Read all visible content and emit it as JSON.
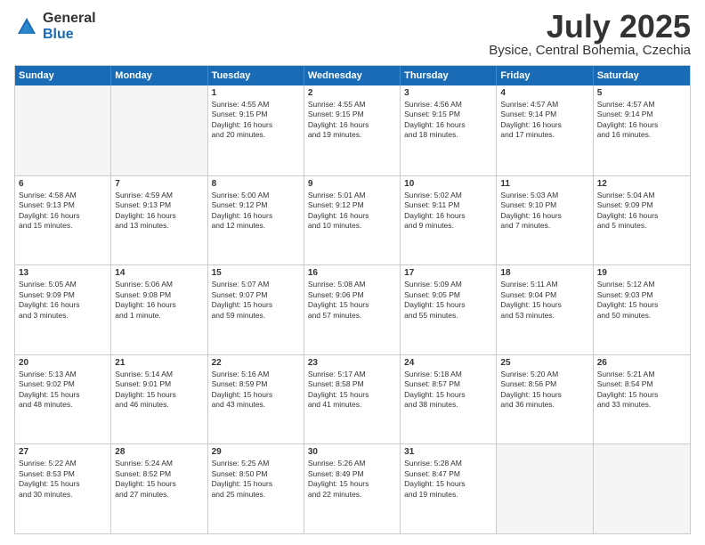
{
  "header": {
    "logo_general": "General",
    "logo_blue": "Blue",
    "title": "July 2025",
    "location": "Bysice, Central Bohemia, Czechia"
  },
  "days_of_week": [
    "Sunday",
    "Monday",
    "Tuesday",
    "Wednesday",
    "Thursday",
    "Friday",
    "Saturday"
  ],
  "weeks": [
    [
      {
        "day": "",
        "lines": [],
        "empty": true
      },
      {
        "day": "",
        "lines": [],
        "empty": true
      },
      {
        "day": "1",
        "lines": [
          "Sunrise: 4:55 AM",
          "Sunset: 9:15 PM",
          "Daylight: 16 hours",
          "and 20 minutes."
        ],
        "empty": false
      },
      {
        "day": "2",
        "lines": [
          "Sunrise: 4:55 AM",
          "Sunset: 9:15 PM",
          "Daylight: 16 hours",
          "and 19 minutes."
        ],
        "empty": false
      },
      {
        "day": "3",
        "lines": [
          "Sunrise: 4:56 AM",
          "Sunset: 9:15 PM",
          "Daylight: 16 hours",
          "and 18 minutes."
        ],
        "empty": false
      },
      {
        "day": "4",
        "lines": [
          "Sunrise: 4:57 AM",
          "Sunset: 9:14 PM",
          "Daylight: 16 hours",
          "and 17 minutes."
        ],
        "empty": false
      },
      {
        "day": "5",
        "lines": [
          "Sunrise: 4:57 AM",
          "Sunset: 9:14 PM",
          "Daylight: 16 hours",
          "and 16 minutes."
        ],
        "empty": false
      }
    ],
    [
      {
        "day": "6",
        "lines": [
          "Sunrise: 4:58 AM",
          "Sunset: 9:13 PM",
          "Daylight: 16 hours",
          "and 15 minutes."
        ],
        "empty": false
      },
      {
        "day": "7",
        "lines": [
          "Sunrise: 4:59 AM",
          "Sunset: 9:13 PM",
          "Daylight: 16 hours",
          "and 13 minutes."
        ],
        "empty": false
      },
      {
        "day": "8",
        "lines": [
          "Sunrise: 5:00 AM",
          "Sunset: 9:12 PM",
          "Daylight: 16 hours",
          "and 12 minutes."
        ],
        "empty": false
      },
      {
        "day": "9",
        "lines": [
          "Sunrise: 5:01 AM",
          "Sunset: 9:12 PM",
          "Daylight: 16 hours",
          "and 10 minutes."
        ],
        "empty": false
      },
      {
        "day": "10",
        "lines": [
          "Sunrise: 5:02 AM",
          "Sunset: 9:11 PM",
          "Daylight: 16 hours",
          "and 9 minutes."
        ],
        "empty": false
      },
      {
        "day": "11",
        "lines": [
          "Sunrise: 5:03 AM",
          "Sunset: 9:10 PM",
          "Daylight: 16 hours",
          "and 7 minutes."
        ],
        "empty": false
      },
      {
        "day": "12",
        "lines": [
          "Sunrise: 5:04 AM",
          "Sunset: 9:09 PM",
          "Daylight: 16 hours",
          "and 5 minutes."
        ],
        "empty": false
      }
    ],
    [
      {
        "day": "13",
        "lines": [
          "Sunrise: 5:05 AM",
          "Sunset: 9:09 PM",
          "Daylight: 16 hours",
          "and 3 minutes."
        ],
        "empty": false
      },
      {
        "day": "14",
        "lines": [
          "Sunrise: 5:06 AM",
          "Sunset: 9:08 PM",
          "Daylight: 16 hours",
          "and 1 minute."
        ],
        "empty": false
      },
      {
        "day": "15",
        "lines": [
          "Sunrise: 5:07 AM",
          "Sunset: 9:07 PM",
          "Daylight: 15 hours",
          "and 59 minutes."
        ],
        "empty": false
      },
      {
        "day": "16",
        "lines": [
          "Sunrise: 5:08 AM",
          "Sunset: 9:06 PM",
          "Daylight: 15 hours",
          "and 57 minutes."
        ],
        "empty": false
      },
      {
        "day": "17",
        "lines": [
          "Sunrise: 5:09 AM",
          "Sunset: 9:05 PM",
          "Daylight: 15 hours",
          "and 55 minutes."
        ],
        "empty": false
      },
      {
        "day": "18",
        "lines": [
          "Sunrise: 5:11 AM",
          "Sunset: 9:04 PM",
          "Daylight: 15 hours",
          "and 53 minutes."
        ],
        "empty": false
      },
      {
        "day": "19",
        "lines": [
          "Sunrise: 5:12 AM",
          "Sunset: 9:03 PM",
          "Daylight: 15 hours",
          "and 50 minutes."
        ],
        "empty": false
      }
    ],
    [
      {
        "day": "20",
        "lines": [
          "Sunrise: 5:13 AM",
          "Sunset: 9:02 PM",
          "Daylight: 15 hours",
          "and 48 minutes."
        ],
        "empty": false
      },
      {
        "day": "21",
        "lines": [
          "Sunrise: 5:14 AM",
          "Sunset: 9:01 PM",
          "Daylight: 15 hours",
          "and 46 minutes."
        ],
        "empty": false
      },
      {
        "day": "22",
        "lines": [
          "Sunrise: 5:16 AM",
          "Sunset: 8:59 PM",
          "Daylight: 15 hours",
          "and 43 minutes."
        ],
        "empty": false
      },
      {
        "day": "23",
        "lines": [
          "Sunrise: 5:17 AM",
          "Sunset: 8:58 PM",
          "Daylight: 15 hours",
          "and 41 minutes."
        ],
        "empty": false
      },
      {
        "day": "24",
        "lines": [
          "Sunrise: 5:18 AM",
          "Sunset: 8:57 PM",
          "Daylight: 15 hours",
          "and 38 minutes."
        ],
        "empty": false
      },
      {
        "day": "25",
        "lines": [
          "Sunrise: 5:20 AM",
          "Sunset: 8:56 PM",
          "Daylight: 15 hours",
          "and 36 minutes."
        ],
        "empty": false
      },
      {
        "day": "26",
        "lines": [
          "Sunrise: 5:21 AM",
          "Sunset: 8:54 PM",
          "Daylight: 15 hours",
          "and 33 minutes."
        ],
        "empty": false
      }
    ],
    [
      {
        "day": "27",
        "lines": [
          "Sunrise: 5:22 AM",
          "Sunset: 8:53 PM",
          "Daylight: 15 hours",
          "and 30 minutes."
        ],
        "empty": false
      },
      {
        "day": "28",
        "lines": [
          "Sunrise: 5:24 AM",
          "Sunset: 8:52 PM",
          "Daylight: 15 hours",
          "and 27 minutes."
        ],
        "empty": false
      },
      {
        "day": "29",
        "lines": [
          "Sunrise: 5:25 AM",
          "Sunset: 8:50 PM",
          "Daylight: 15 hours",
          "and 25 minutes."
        ],
        "empty": false
      },
      {
        "day": "30",
        "lines": [
          "Sunrise: 5:26 AM",
          "Sunset: 8:49 PM",
          "Daylight: 15 hours",
          "and 22 minutes."
        ],
        "empty": false
      },
      {
        "day": "31",
        "lines": [
          "Sunrise: 5:28 AM",
          "Sunset: 8:47 PM",
          "Daylight: 15 hours",
          "and 19 minutes."
        ],
        "empty": false
      },
      {
        "day": "",
        "lines": [],
        "empty": true
      },
      {
        "day": "",
        "lines": [],
        "empty": true
      }
    ]
  ]
}
